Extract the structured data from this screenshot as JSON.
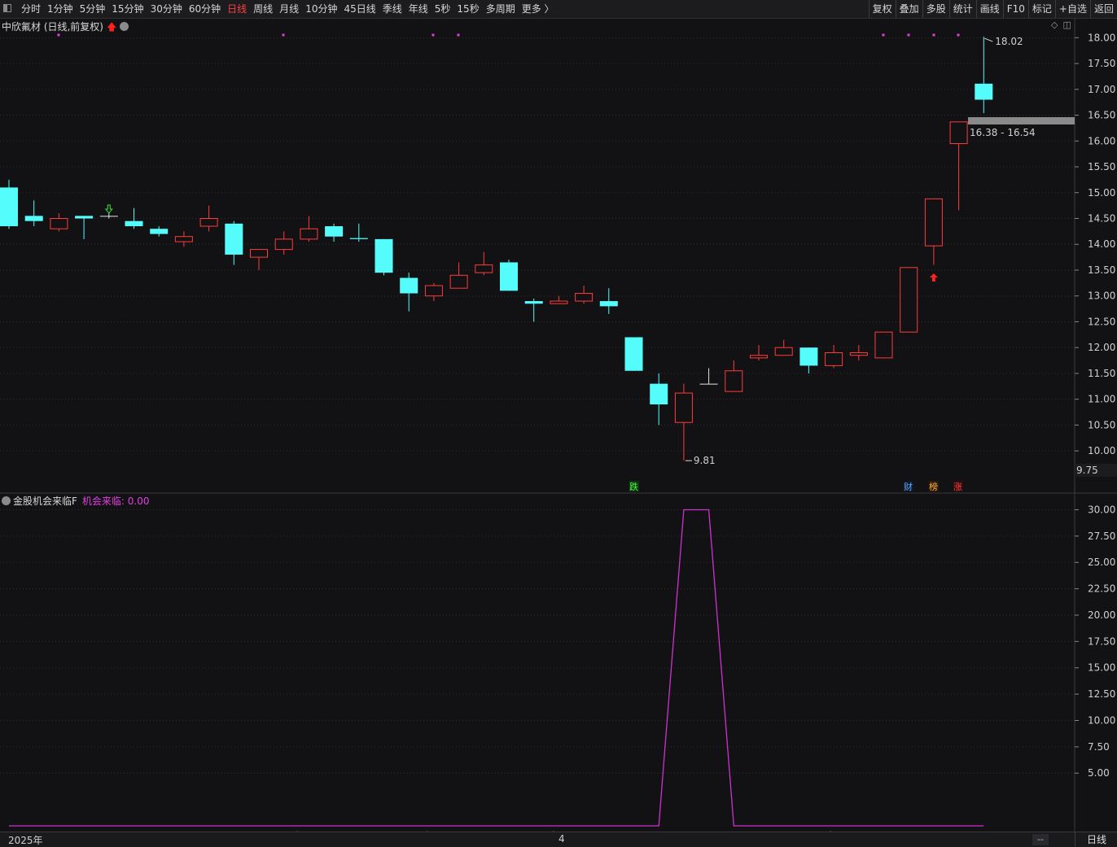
{
  "toolbar": {
    "periods": [
      "分时",
      "1分钟",
      "5分钟",
      "15分钟",
      "30分钟",
      "60分钟",
      "日线",
      "周线",
      "月线",
      "10分钟",
      "45日线",
      "季线",
      "年线",
      "5秒",
      "15秒",
      "多周期",
      "更多 〉"
    ],
    "active_period": "日线",
    "tools": [
      "复权",
      "叠加",
      "多股",
      "统计",
      "画线",
      "F10",
      "标记",
      "+自选",
      "返回"
    ]
  },
  "main_chart": {
    "title": "中欣氟材 (日线,前复权)",
    "high_label": "18.02",
    "low_label": "9.81",
    "price_range_label": "16.38 - 16.54",
    "axis_bottom_label": "9.75",
    "markers": [
      "跌",
      "财",
      "榜",
      "涨"
    ],
    "colors": {
      "up": "#ff3b3b",
      "down": "#54fcfc",
      "background": "#121214"
    }
  },
  "sub_chart": {
    "title": "金股机会来临F",
    "value_label": "机会来临: 0.00",
    "line_color": "#d030d0"
  },
  "bottom": {
    "date_left": "2025年",
    "date_mid": "4",
    "dash": "--",
    "period": "日线"
  },
  "chart_data": [
    {
      "type": "candlestick",
      "title": "中欣氟材 (日线,前复权)",
      "ylim": [
        9.75,
        18.1
      ],
      "yticks": [
        "18.00",
        "17.50",
        "17.00",
        "16.50",
        "16.00",
        "15.50",
        "15.00",
        "14.50",
        "14.00",
        "13.50",
        "13.00",
        "12.50",
        "12.00",
        "11.50",
        "11.00",
        "10.50",
        "10.00"
      ],
      "candles": [
        {
          "o": 15.1,
          "h": 15.25,
          "l": 14.3,
          "c": 14.35
        },
        {
          "o": 14.55,
          "h": 14.85,
          "l": 14.35,
          "c": 14.45
        },
        {
          "o": 14.3,
          "h": 14.6,
          "l": 14.25,
          "c": 14.5
        },
        {
          "o": 14.55,
          "h": 14.55,
          "l": 14.1,
          "c": 14.5
        },
        {
          "o": 14.55,
          "h": 14.62,
          "l": 14.5,
          "c": 14.55
        },
        {
          "o": 14.45,
          "h": 14.7,
          "l": 14.3,
          "c": 14.35
        },
        {
          "o": 14.3,
          "h": 14.35,
          "l": 14.15,
          "c": 14.2
        },
        {
          "o": 14.05,
          "h": 14.25,
          "l": 13.95,
          "c": 14.15
        },
        {
          "o": 14.35,
          "h": 14.75,
          "l": 14.25,
          "c": 14.5
        },
        {
          "o": 14.4,
          "h": 14.45,
          "l": 13.6,
          "c": 13.8
        },
        {
          "o": 13.75,
          "h": 13.9,
          "l": 13.5,
          "c": 13.9
        },
        {
          "o": 13.9,
          "h": 14.25,
          "l": 13.8,
          "c": 14.1
        },
        {
          "o": 14.1,
          "h": 14.55,
          "l": 14.05,
          "c": 14.3
        },
        {
          "o": 14.35,
          "h": 14.4,
          "l": 14.05,
          "c": 14.15
        },
        {
          "o": 14.12,
          "h": 14.4,
          "l": 14.05,
          "c": 14.1
        },
        {
          "o": 14.1,
          "h": 14.1,
          "l": 13.4,
          "c": 13.45
        },
        {
          "o": 13.35,
          "h": 13.45,
          "l": 12.7,
          "c": 13.05
        },
        {
          "o": 13.0,
          "h": 13.25,
          "l": 12.9,
          "c": 13.2
        },
        {
          "o": 13.15,
          "h": 13.65,
          "l": 13.15,
          "c": 13.4
        },
        {
          "o": 13.45,
          "h": 13.85,
          "l": 13.4,
          "c": 13.6
        },
        {
          "o": 13.65,
          "h": 13.7,
          "l": 13.1,
          "c": 13.1
        },
        {
          "o": 12.9,
          "h": 12.95,
          "l": 12.5,
          "c": 12.85
        },
        {
          "o": 12.85,
          "h": 13.0,
          "l": 12.85,
          "c": 12.9
        },
        {
          "o": 12.9,
          "h": 13.2,
          "l": 12.85,
          "c": 13.05
        },
        {
          "o": 12.9,
          "h": 13.15,
          "l": 12.65,
          "c": 12.8
        },
        {
          "o": 12.2,
          "h": 12.2,
          "l": 11.55,
          "c": 11.55
        },
        {
          "o": 11.3,
          "h": 11.5,
          "l": 10.5,
          "c": 10.9
        },
        {
          "o": 10.55,
          "h": 11.3,
          "l": 9.81,
          "c": 11.12
        },
        {
          "o": 11.3,
          "h": 11.6,
          "l": 11.3,
          "c": 11.3
        },
        {
          "o": 11.15,
          "h": 11.75,
          "l": 11.15,
          "c": 11.55
        },
        {
          "o": 11.8,
          "h": 12.05,
          "l": 11.75,
          "c": 11.85
        },
        {
          "o": 11.85,
          "h": 12.15,
          "l": 11.85,
          "c": 12.0
        },
        {
          "o": 12.0,
          "h": 12.0,
          "l": 11.5,
          "c": 11.65
        },
        {
          "o": 11.65,
          "h": 12.05,
          "l": 11.6,
          "c": 11.9
        },
        {
          "o": 11.85,
          "h": 12.05,
          "l": 11.75,
          "c": 11.9
        },
        {
          "o": 11.8,
          "h": 12.3,
          "l": 11.8,
          "c": 12.3
        },
        {
          "o": 12.3,
          "h": 13.55,
          "l": 12.3,
          "c": 13.55
        },
        {
          "o": 13.97,
          "h": 14.88,
          "l": 13.6,
          "c": 14.88
        },
        {
          "o": 15.95,
          "h": 16.37,
          "l": 14.66,
          "c": 16.37
        },
        {
          "o": 17.11,
          "h": 18.02,
          "l": 16.54,
          "c": 16.8
        }
      ]
    },
    {
      "type": "line",
      "title": "金股机会来临F",
      "ylim": [
        0,
        30.5
      ],
      "yticks": [
        "30.00",
        "27.50",
        "25.00",
        "22.50",
        "20.00",
        "17.50",
        "15.00",
        "12.50",
        "10.00",
        "7.50",
        "5.00"
      ],
      "series": [
        {
          "name": "机会来临",
          "values": [
            0,
            0,
            0,
            0,
            0,
            0,
            0,
            0,
            0,
            0,
            0,
            0,
            0,
            0,
            0,
            0,
            0,
            0,
            0,
            0,
            0,
            0,
            0,
            0,
            0,
            0,
            0,
            30,
            30,
            0,
            0,
            0,
            0,
            0,
            0,
            0,
            0,
            0,
            0,
            0
          ]
        }
      ]
    }
  ]
}
